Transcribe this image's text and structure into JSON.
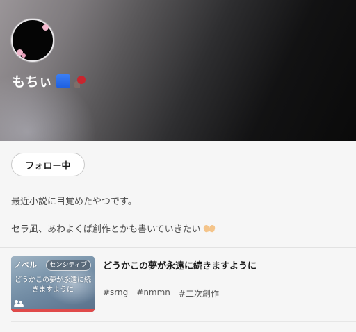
{
  "profile": {
    "name": "もちぃ",
    "follow_label": "フォロー中",
    "bio_lines": [
      "最近小説に目覚めたやつです。",
      "セラ凪、あわよくば創作とかも書いていきたい"
    ]
  },
  "works": [
    {
      "genre": "ノベル",
      "badge": "センシティブ",
      "thumbnail_title": "どうかこの夢が永遠に続きますように",
      "title": "どうかこの夢が永遠に続きますように",
      "tags": [
        "#srng",
        "#nmmn",
        "#二次創作"
      ]
    }
  ],
  "icons": [
    "blue-square-icon",
    "goldfish-icon",
    "hands-icon",
    "group-icon"
  ],
  "colors": {
    "accent_bar": "#e04a4a",
    "name_text": "#ffffff"
  }
}
